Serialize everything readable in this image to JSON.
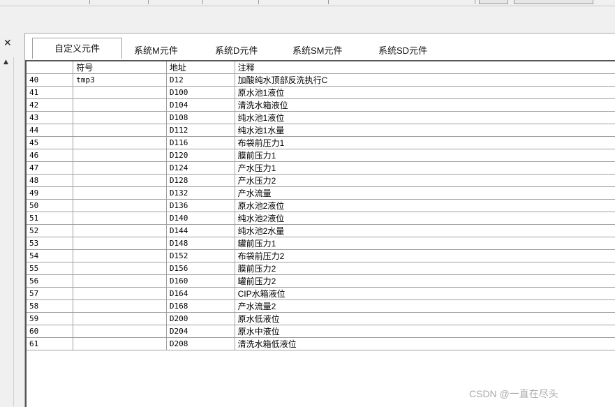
{
  "tabs": [
    "自定义元件",
    "系统M元件",
    "系统D元件",
    "系统SM元件",
    "系统SD元件"
  ],
  "active_tab": 0,
  "columns": [
    "",
    "符号",
    "地址",
    "注释"
  ],
  "rows": [
    {
      "num": "40",
      "symbol": "tmp3",
      "address": "D12",
      "comment": "加酸纯水顶部反洗执行C"
    },
    {
      "num": "41",
      "symbol": "",
      "address": "D100",
      "comment": "原水池1液位"
    },
    {
      "num": "42",
      "symbol": "",
      "address": "D104",
      "comment": "清洗水箱液位"
    },
    {
      "num": "43",
      "symbol": "",
      "address": "D108",
      "comment": "纯水池1液位"
    },
    {
      "num": "44",
      "symbol": "",
      "address": "D112",
      "comment": "纯水池1水量"
    },
    {
      "num": "45",
      "symbol": "",
      "address": "D116",
      "comment": "布袋前压力1"
    },
    {
      "num": "46",
      "symbol": "",
      "address": "D120",
      "comment": "膜前压力1"
    },
    {
      "num": "47",
      "symbol": "",
      "address": "D124",
      "comment": "产水压力1"
    },
    {
      "num": "48",
      "symbol": "",
      "address": "D128",
      "comment": "产水压力2"
    },
    {
      "num": "49",
      "symbol": "",
      "address": "D132",
      "comment": "产水流量"
    },
    {
      "num": "50",
      "symbol": "",
      "address": "D136",
      "comment": "原水池2液位"
    },
    {
      "num": "51",
      "symbol": "",
      "address": "D140",
      "comment": "纯水池2液位"
    },
    {
      "num": "52",
      "symbol": "",
      "address": "D144",
      "comment": "纯水池2水量"
    },
    {
      "num": "53",
      "symbol": "",
      "address": "D148",
      "comment": "罐前压力1"
    },
    {
      "num": "54",
      "symbol": "",
      "address": "D152",
      "comment": "布袋前压力2"
    },
    {
      "num": "55",
      "symbol": "",
      "address": "D156",
      "comment": "膜前压力2"
    },
    {
      "num": "56",
      "symbol": "",
      "address": "D160",
      "comment": "罐前压力2"
    },
    {
      "num": "57",
      "symbol": "",
      "address": "D164",
      "comment": "CIP水箱液位"
    },
    {
      "num": "58",
      "symbol": "",
      "address": "D168",
      "comment": "产水流量2"
    },
    {
      "num": "59",
      "symbol": "",
      "address": "D200",
      "comment": "原水低液位"
    },
    {
      "num": "60",
      "symbol": "",
      "address": "D204",
      "comment": "原水中液位"
    },
    {
      "num": "61",
      "symbol": "",
      "address": "D208",
      "comment": "清洗水箱低液位"
    }
  ],
  "watermark": "CSDN @一直在尽头",
  "icons": {
    "close": "close-icon",
    "scroll_up": "scroll-up-arrow-icon"
  }
}
